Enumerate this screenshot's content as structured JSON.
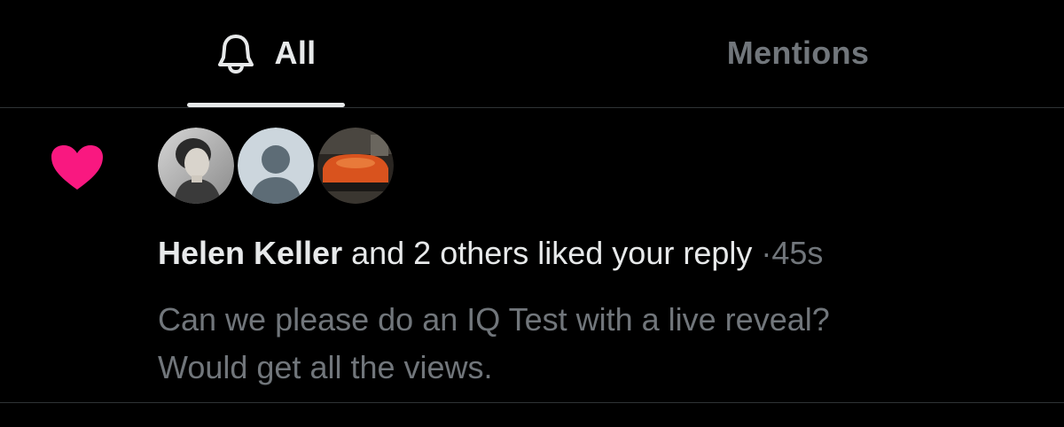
{
  "tabs": [
    {
      "label": "All",
      "icon": "bell-icon",
      "active": true
    },
    {
      "label": "Mentions",
      "active": false
    }
  ],
  "notification": {
    "icon": "heart-icon",
    "icon_color": "#f91880",
    "actor": "Helen Keller",
    "action": "and 2 others liked your reply",
    "separator": "·",
    "timestamp": "45s",
    "quote_lines": [
      "Can we please do an IQ Test with a live reveal?",
      "Would get all the views."
    ]
  },
  "colors": {
    "background": "#000000",
    "primary_text": "#e7e9ea",
    "secondary_text": "#71767b",
    "divider": "#2f3336",
    "like": "#f91880"
  }
}
